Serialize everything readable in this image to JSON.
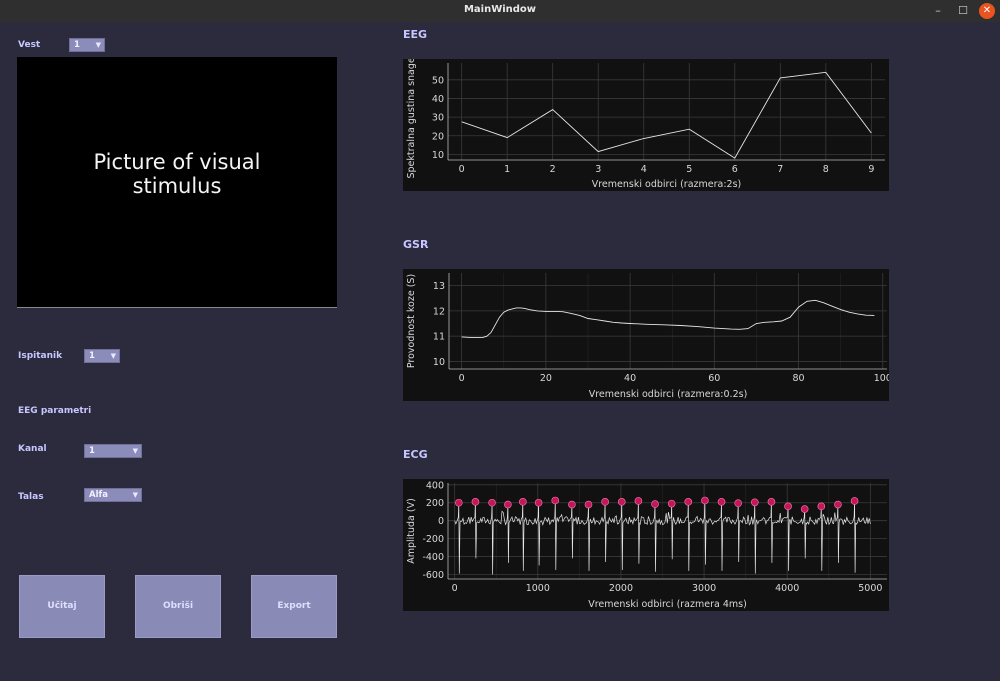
{
  "window": {
    "title": "MainWindow",
    "minimize": "–",
    "maximize": "☐",
    "close": "✕"
  },
  "left": {
    "vest_label": "Vest",
    "vest_value": "1",
    "stimulus_text": "Picture of visual\nstimulus",
    "ispitanik_label": "Ispitanik",
    "ispitanik_value": "1",
    "eeg_params_label": "EEG parametri",
    "kanal_label": "Kanal",
    "kanal_value": "1",
    "talas_label": "Talas",
    "talas_value": "Alfa",
    "buttons": {
      "ucitaj": "Učitaj",
      "obrisi": "Obriši",
      "export": "Export"
    }
  },
  "sections": {
    "eeg": "EEG",
    "gsr": "GSR",
    "ecg": "ECG"
  },
  "colors": {
    "line": "#e6e6e6",
    "marker": "#c2185b",
    "plot_bg": "#111111"
  },
  "chart_data": [
    {
      "id": "eeg",
      "type": "line",
      "x": [
        0,
        1,
        2,
        3,
        4,
        5,
        6,
        7,
        8,
        9
      ],
      "values": [
        27.5,
        19,
        34,
        11.5,
        18.5,
        23.5,
        8,
        51,
        54,
        21.5
      ],
      "xlim": [
        -0.3,
        9.3
      ],
      "ylim": [
        7,
        59
      ],
      "xticks": [
        "0",
        "1",
        "2",
        "3",
        "4",
        "5",
        "6",
        "7",
        "8",
        "9"
      ],
      "yticks": [
        "10",
        "20",
        "30",
        "40",
        "50"
      ],
      "xlabel": "Vremenski odbirci (razmera:2s)",
      "ylabel": "Spektralna gustina snage (n",
      "grid": true
    },
    {
      "id": "gsr",
      "type": "line",
      "x": [
        0,
        2,
        4,
        5,
        6,
        7,
        8,
        9,
        10,
        11,
        12,
        13,
        14,
        15,
        16,
        18,
        20,
        22,
        24,
        26,
        28,
        30,
        32,
        34,
        36,
        38,
        40,
        44,
        48,
        52,
        56,
        60,
        62,
        64,
        66,
        68,
        70,
        72,
        74,
        76,
        78,
        80,
        82,
        84,
        86,
        88,
        90,
        92,
        94,
        96,
        98
      ],
      "values": [
        10.97,
        10.95,
        10.95,
        10.95,
        11.0,
        11.15,
        11.45,
        11.75,
        11.95,
        12.03,
        12.08,
        12.12,
        12.12,
        12.1,
        12.05,
        12.0,
        11.98,
        11.98,
        11.97,
        11.9,
        11.82,
        11.7,
        11.65,
        11.6,
        11.55,
        11.52,
        11.5,
        11.47,
        11.45,
        11.42,
        11.38,
        11.32,
        11.3,
        11.28,
        11.27,
        11.3,
        11.5,
        11.55,
        11.57,
        11.6,
        11.75,
        12.15,
        12.38,
        12.42,
        12.32,
        12.18,
        12.05,
        11.95,
        11.88,
        11.83,
        11.82
      ],
      "xlim": [
        -3,
        101
      ],
      "ylim": [
        9.7,
        13.5
      ],
      "xticks": [
        "0",
        "20",
        "40",
        "60",
        "80",
        "100"
      ],
      "yticks": [
        "10",
        "11",
        "12",
        "13"
      ],
      "xlabel": "Vremenski odbirci (razmera:0.2s)",
      "ylabel": "Provodnost koze (S)",
      "grid": true
    },
    {
      "id": "ecg",
      "type": "line",
      "beats_x": [
        50,
        250,
        450,
        640,
        820,
        1010,
        1210,
        1410,
        1610,
        1810,
        2010,
        2210,
        2410,
        2610,
        2810,
        3010,
        3210,
        3410,
        3610,
        3810,
        4010,
        4210,
        4410,
        4610,
        4810
      ],
      "r_peaks": [
        200,
        210,
        200,
        180,
        210,
        200,
        225,
        180,
        180,
        210,
        210,
        220,
        185,
        190,
        210,
        225,
        210,
        195,
        205,
        210,
        160,
        130,
        160,
        180,
        220
      ],
      "s_troughs": [
        -590,
        -420,
        -600,
        -470,
        -560,
        -500,
        -550,
        -420,
        -560,
        -460,
        -550,
        -480,
        -570,
        -430,
        -560,
        -490,
        -560,
        -460,
        -590,
        -470,
        -560,
        -420,
        -560,
        -470,
        -580
      ],
      "marker_y": [
        200,
        210,
        200,
        180,
        210,
        200,
        225,
        180,
        180,
        210,
        210,
        220,
        185,
        190,
        210,
        225,
        210,
        195,
        205,
        210,
        160,
        130,
        160,
        180,
        220
      ],
      "xlim": [
        -80,
        5200
      ],
      "ylim": [
        -650,
        420
      ],
      "xticks": [
        "0",
        "1000",
        "2000",
        "3000",
        "4000",
        "5000"
      ],
      "yticks": [
        "400",
        "200",
        "0",
        "-200",
        "-400",
        "-600"
      ],
      "xlabel": "Vremenski odbirci (razmera 4ms)",
      "ylabel": "Amplituda (V)",
      "grid": true
    }
  ]
}
